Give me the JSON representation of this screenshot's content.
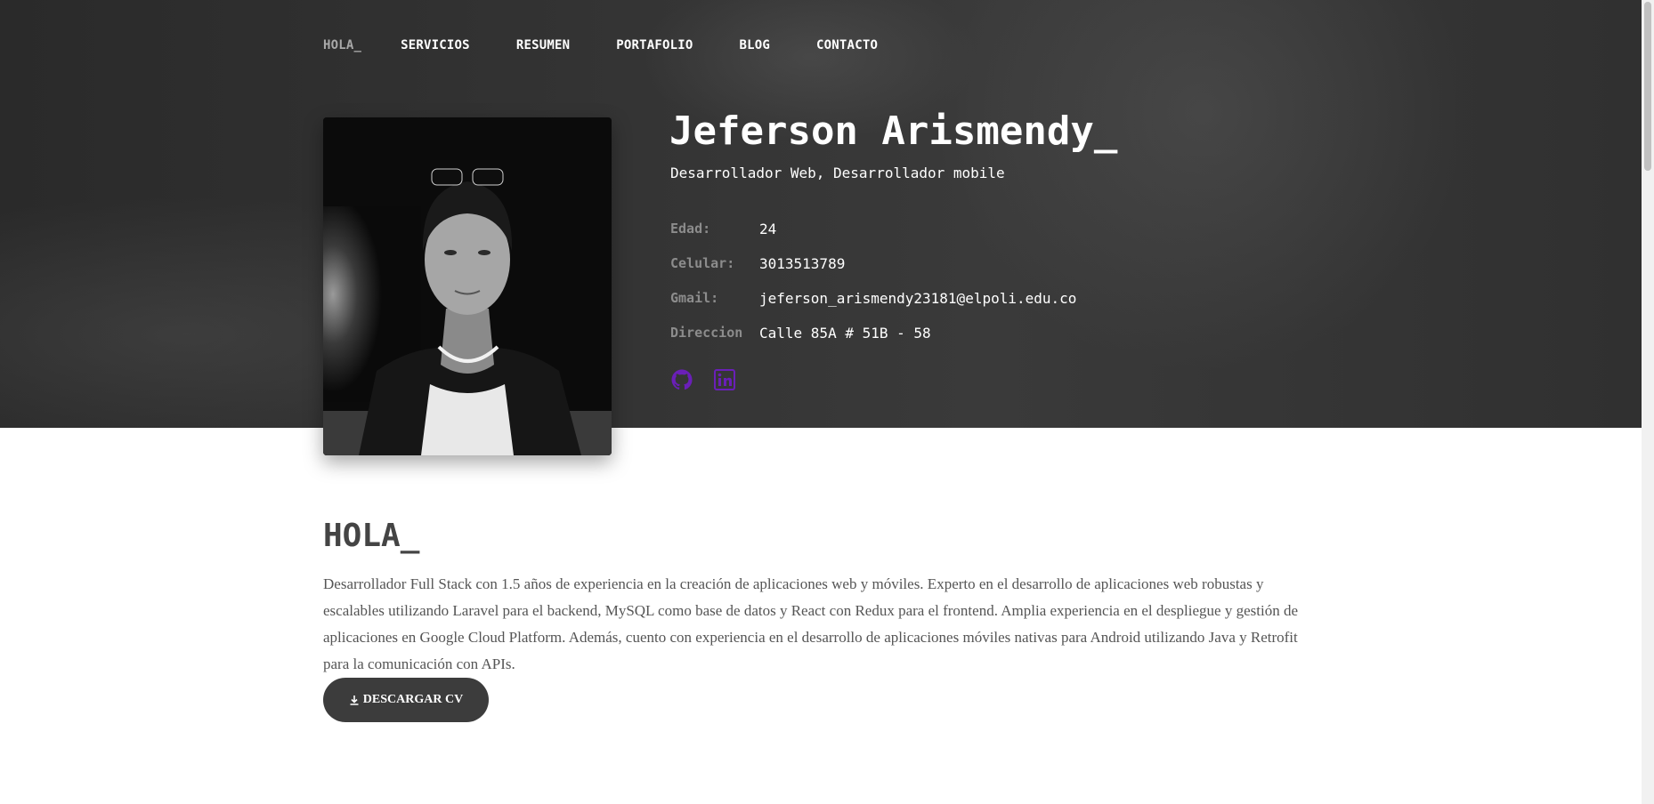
{
  "nav": {
    "items": [
      {
        "label": "HOLA_"
      },
      {
        "label": "SERVICIOS"
      },
      {
        "label": "RESUMEN"
      },
      {
        "label": "PORTAFOLIO"
      },
      {
        "label": "BLOG"
      },
      {
        "label": "CONTACTO"
      }
    ],
    "active_index": 0
  },
  "profile": {
    "name": "Jeferson Arismendy_",
    "subtitle": "Desarrollador Web, Desarrollador mobile",
    "info": [
      {
        "label": "Edad:",
        "value": "24"
      },
      {
        "label": "Celular:",
        "value": "3013513789"
      },
      {
        "label": "Gmail:",
        "value": "jeferson_arismendy23181@elpoli.edu.co"
      },
      {
        "label": "Direccion",
        "value": "Calle 85A # 51B - 58"
      }
    ],
    "socials": [
      {
        "icon": "github-icon"
      },
      {
        "icon": "linkedin-icon"
      }
    ]
  },
  "about": {
    "title": "HOLA_",
    "text": "Desarrollador Full Stack con 1.5 años de experiencia en la creación de aplicaciones web y móviles. Experto en el desarrollo de aplicaciones web robustas y escalables utilizando Laravel para el backend, MySQL como base de datos y React con Redux para el frontend. Amplia experiencia en el despliegue y gestión de aplicaciones en Google Cloud Platform. Además, cuento con experiencia en el desarrollo de aplicaciones móviles nativas para Android utilizando Java y Retrofit para la comunicación con APIs.",
    "cv_button": "DESCARGAR CV"
  },
  "colors": {
    "hero_bg": "#333333",
    "accent": "#6a1fb8",
    "nav_active": "#a9a9a9",
    "button_bg": "#3c3c3c"
  }
}
